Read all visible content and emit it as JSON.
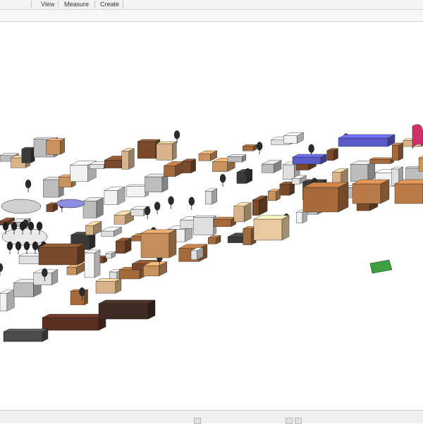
{
  "ribbon": {
    "tabs": [
      {
        "id": "view",
        "label": "View"
      },
      {
        "id": "measure",
        "label": "Measure"
      },
      {
        "id": "create",
        "label": "Create"
      }
    ]
  },
  "viewport": {
    "content": "3D view of office furniture family library",
    "accent_colors": {
      "wood_dark": "#7a4a2a",
      "wood_light": "#c8935e",
      "blue": "#5a5ac8",
      "magenta": "#d0306a",
      "green": "#3fa03f",
      "dark": "#3a3a3a"
    }
  }
}
